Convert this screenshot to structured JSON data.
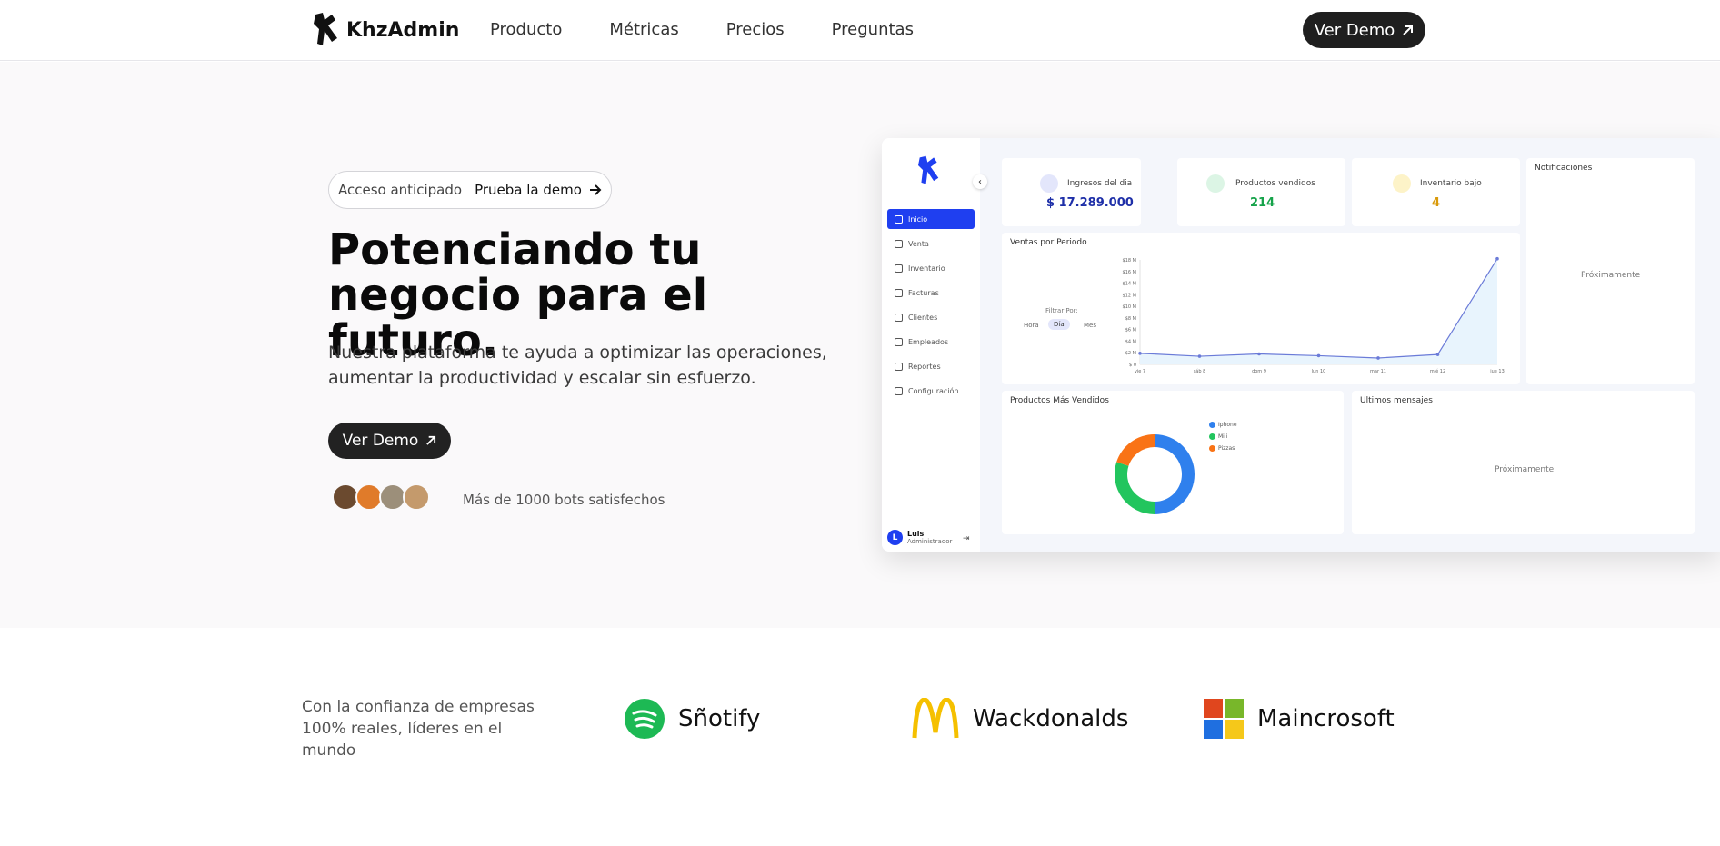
{
  "nav": {
    "brand": "KhzAdmin",
    "links": [
      "Producto",
      "Métricas",
      "Precios",
      "Preguntas"
    ],
    "cta": "Ver Demo"
  },
  "hero": {
    "pill_label": "Acceso anticipado",
    "pill_link": "Prueba la demo",
    "headline_line1": "Potenciando tu",
    "headline_line2": "negocio para el futuro.",
    "subtext": "Nuestra plataforma te ayuda a optimizar las operaciones, aumentar la productividad y escalar sin esfuerzo.",
    "cta": "Ver Demo",
    "social_proof": "Más de 1000 bots satisfechos"
  },
  "dashboard": {
    "sidebar": [
      "Inicio",
      "Venta",
      "Inventario",
      "Facturas",
      "Clientes",
      "Empleados",
      "Reportes",
      "Configuración"
    ],
    "user_initial": "L",
    "user_name": "Luis",
    "user_role": "Administrador",
    "stats": [
      {
        "title": "Ingresos del dia",
        "value": "$ 17.289.000",
        "color": "#1e2fa8"
      },
      {
        "title": "Productos vendidos",
        "value": "214",
        "color": "#16a34a"
      },
      {
        "title": "Inventario bajo",
        "value": "4",
        "color": "#d99a0b"
      }
    ],
    "notifications_title": "Notificaciones",
    "notifications_soon": "Próximamente",
    "sales_title": "Ventas por Periodo",
    "filter_label": "Filtrar Por:",
    "filters": [
      "Hora",
      "Día",
      "Mes"
    ],
    "top_products_title": "Productos Más Vendidos",
    "messages_title": "Ultimos mensajes",
    "messages_soon": "Próximamente"
  },
  "chart_data": [
    {
      "type": "line",
      "title": "Ventas por Periodo",
      "x": [
        "vie 7",
        "sáb 8",
        "dom 9",
        "lun 10",
        "mar 11",
        "mié 12",
        "jue 13"
      ],
      "values": [
        1.9,
        1.4,
        1.8,
        1.5,
        1.1,
        1.7,
        18.2
      ],
      "yticks": [
        "$18 M",
        "$16 M",
        "$14 M",
        "$12 M",
        "$10 M",
        "$8 M",
        "$6 M",
        "$4 M",
        "$2 M",
        "$ 0"
      ],
      "ylim": [
        0,
        18
      ],
      "color": "#6b7bd8"
    },
    {
      "type": "pie",
      "title": "Productos Más Vendidos",
      "categories": [
        "Iphone",
        "Mili",
        "Pizzas"
      ],
      "values": [
        50,
        30,
        20
      ],
      "colors": [
        "#2f80ed",
        "#22c55e",
        "#f97316"
      ]
    }
  ],
  "trust": {
    "text_line1": "Con la confianza de empresas",
    "text_line2": "100% reales, líderes en el mundo",
    "brands": [
      "Sñotify",
      "Wackdonalds",
      "Maincrosoft"
    ]
  }
}
